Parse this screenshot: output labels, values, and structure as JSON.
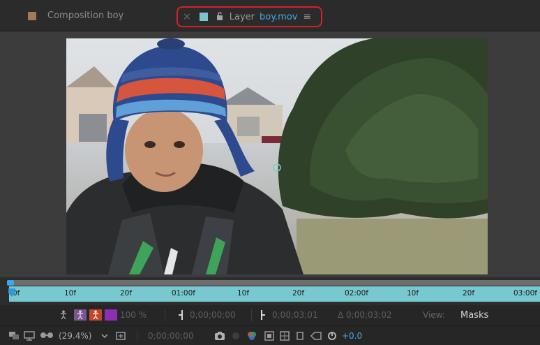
{
  "tabs": {
    "composition": {
      "label": "Composition boy",
      "color": "#a47a4e"
    },
    "layer": {
      "close": "×",
      "label": "Layer",
      "file": "boy.mov",
      "menu": "≡",
      "color": "#7cc4cf",
      "highlight": "#d8202c"
    }
  },
  "viewer": {
    "image_subject": "boy-in-knit-hat-footage"
  },
  "timeruler": {
    "ticks": [
      "0f",
      "10f",
      "20f",
      "01:00f",
      "10f",
      "20f",
      "02:00f",
      "10f",
      "20f",
      "03:00f"
    ],
    "playhead_color": "#3ba9e4",
    "bar_color": "#78c9cf"
  },
  "controls": {
    "opacity": "100 %",
    "in_point": "0;00;00;00",
    "out_point": "0;00;03;01",
    "duration": "Δ 0;00;03;02",
    "view_label": "View:",
    "view_value": "Masks"
  },
  "status": {
    "zoom": "(29.4%)",
    "timecode": "0;00;00;00",
    "exposure": "+0.0"
  }
}
